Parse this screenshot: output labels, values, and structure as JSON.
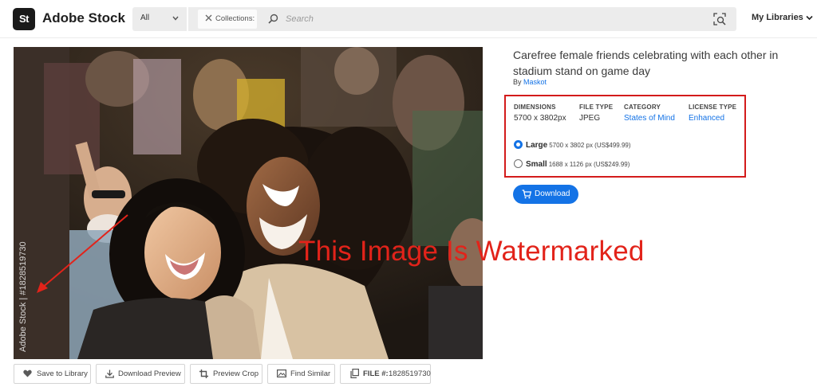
{
  "header": {
    "logo_text": "St",
    "brand": "Adobe Stock",
    "filter": {
      "label": "All",
      "icon": "chevron-down-icon"
    },
    "chip": {
      "label": "Collections:",
      "icon": "close-icon"
    },
    "search": {
      "placeholder": "Search",
      "value": "",
      "icon": "search-icon"
    },
    "visual_search_icon": "visual-search-icon",
    "my_libraries": "My Libraries"
  },
  "photo": {
    "side_watermark": "Adobe Stock | #1828519730"
  },
  "annotation": {
    "watermark_note": "This Image Is Watermarked",
    "color": "#e2231a"
  },
  "asset": {
    "title": "Carefree female friends celebrating with each other in stadium stand on game day",
    "by_label": "By",
    "author": "Maskot",
    "details": [
      {
        "key": "dimensions",
        "label": "DIMENSIONS",
        "value": "5700 x 3802px",
        "link": false
      },
      {
        "key": "file_type",
        "label": "FILE TYPE",
        "value": "JPEG",
        "link": false
      },
      {
        "key": "category",
        "label": "CATEGORY",
        "value": "States of Mind",
        "link": true
      },
      {
        "key": "license_type",
        "label": "LICENSE TYPE",
        "value": "Enhanced",
        "link": true
      }
    ],
    "sizes": [
      {
        "name": "Large",
        "detail": "5700 x 3802 px (US$499.99)",
        "selected": true
      },
      {
        "name": "Small",
        "detail": "1688 x 1126 px (US$249.99)",
        "selected": false
      }
    ],
    "download_label": "Download"
  },
  "actions": {
    "save": "Save to Library",
    "download_preview": "Download Preview",
    "preview_crop": "Preview Crop",
    "find_similar": "Find Similar",
    "file_label": "FILE #:",
    "file_number": "1828519730"
  },
  "colors": {
    "accent": "#1473e6",
    "highlight_border": "#d31b1b"
  }
}
